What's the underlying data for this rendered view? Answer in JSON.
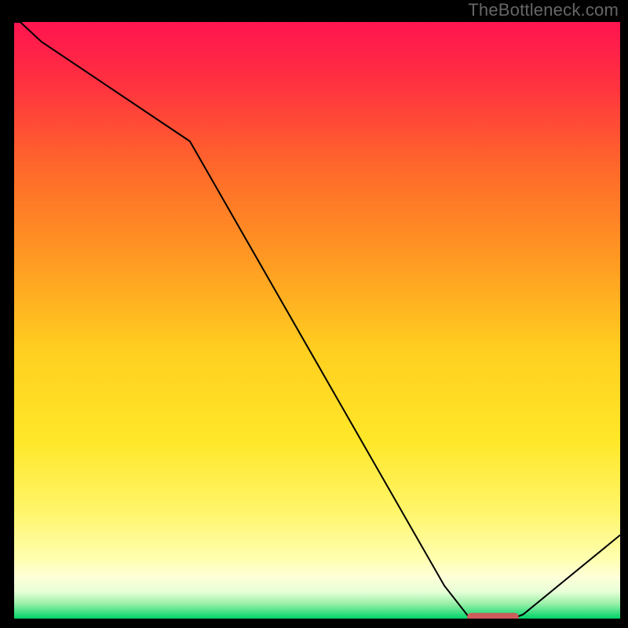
{
  "watermark": "TheBottleneck.com",
  "chart_data": {
    "type": "line",
    "title": "",
    "xlabel": "",
    "ylabel": "",
    "x": [
      0.0,
      0.01,
      0.045,
      0.29,
      0.71,
      0.75,
      0.83,
      0.84,
      1.0
    ],
    "y": [
      1.0,
      1.0,
      0.967,
      0.8,
      0.055,
      0.003,
      0.003,
      0.007,
      0.14
    ],
    "optimum_indicator": {
      "x_center": 0.79,
      "width": 0.085,
      "y": 0.003,
      "color": "#cd5c5c"
    },
    "xlim": [
      0,
      1
    ],
    "ylim": [
      0,
      1
    ],
    "gradient_stops": [
      {
        "offset": 0.0,
        "color": "#ff1450"
      },
      {
        "offset": 0.1,
        "color": "#ff3040"
      },
      {
        "offset": 0.25,
        "color": "#ff6a2a"
      },
      {
        "offset": 0.4,
        "color": "#ff9a22"
      },
      {
        "offset": 0.55,
        "color": "#ffcf20"
      },
      {
        "offset": 0.7,
        "color": "#ffe728"
      },
      {
        "offset": 0.82,
        "color": "#fff56a"
      },
      {
        "offset": 0.9,
        "color": "#ffffb0"
      },
      {
        "offset": 0.93,
        "color": "#feffd8"
      },
      {
        "offset": 0.955,
        "color": "#e8ffd8"
      },
      {
        "offset": 0.975,
        "color": "#9af0a8"
      },
      {
        "offset": 1.0,
        "color": "#00d46a"
      }
    ],
    "curve_color": "#000000",
    "curve_width": 2
  }
}
